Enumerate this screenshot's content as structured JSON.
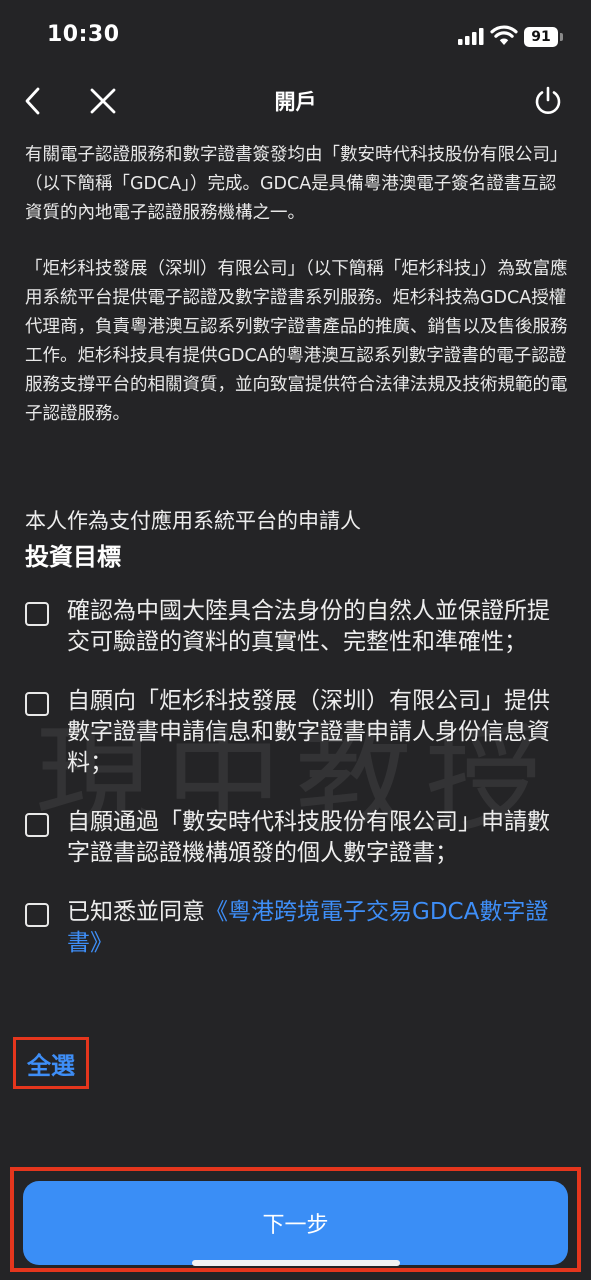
{
  "status_bar": {
    "time": "10:30",
    "battery": "91"
  },
  "nav": {
    "title": "開戶",
    "back_icon": "chevron-left-icon",
    "close_icon": "close-icon",
    "power_icon": "power-icon"
  },
  "intro": {
    "paragraphs": [
      "有關電子認證服務和數字證書簽發均由「數安時代科技股份有限公司」（以下簡稱「GDCA」）完成。GDCA是具備粵港澳電子簽名證書互認資質的內地電子認證服務機構之一。",
      "「炬杉科技發展（深圳）有限公司」（以下簡稱「炬杉科技」）為致富應用系統平台提供電子認證及數字證書系列服務。炬杉科技為GDCA授權代理商，負責粵港澳互認系列數字證書產品的推廣、銷售以及售後服務工作。炬杉科技具有提供GDCA的粵港澳互認系列數字證書的電子認證服務支撐平台的相關資質，並向致富提供符合法律法規及技術規範的電子認證服務。"
    ]
  },
  "applicant_line": "本人作為支付應用系統平台的申請人",
  "section_title": "投資目標",
  "checklist": [
    {
      "text": "確認為中國大陸具合法身份的自然人並保證所提交可驗證的資料的真實性、完整性和準確性；",
      "checked": false
    },
    {
      "text": "自願向「炬杉科技發展（深圳）有限公司」提供數字證書申請信息和數字證書申請人身份信息資料；",
      "checked": false
    },
    {
      "text": "自願通過「數安時代科技股份有限公司」申請數字證書認證機構頒發的個人數字證書；",
      "checked": false
    },
    {
      "text": "已知悉並同意",
      "link": "《粵港跨境電子交易GDCA數字證書》",
      "checked": false
    }
  ],
  "select_all_label": "全選",
  "next_button_label": "下一步",
  "watermark_text": "現中教授",
  "colors": {
    "background": "#242426",
    "accent": "#3a8ef6",
    "link": "#3e8ef7",
    "highlight_frame": "#e5361d"
  }
}
